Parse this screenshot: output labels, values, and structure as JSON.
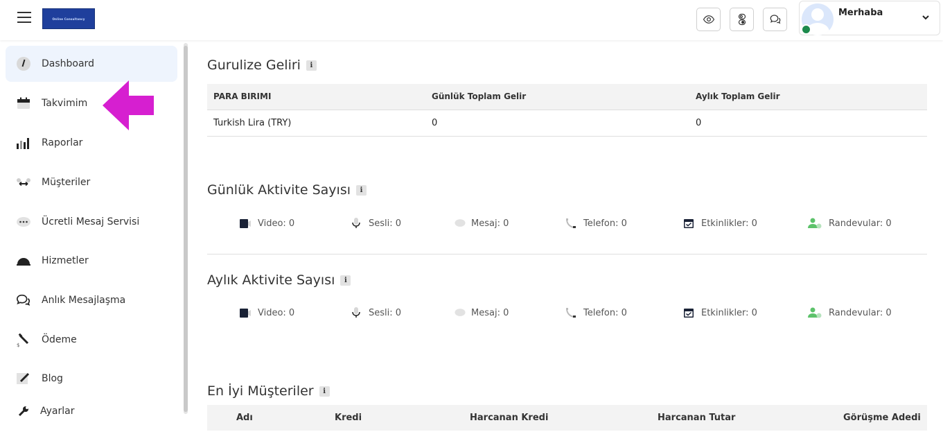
{
  "header": {
    "logo_text": "Online Consultancy",
    "greeting": "Merhaba",
    "chevron": "⌄",
    "icons": [
      "eye-icon",
      "toggle-icon",
      "chat-icon"
    ]
  },
  "sidebar": {
    "items": [
      {
        "label": "Dashboard",
        "icon": "dashboard-icon"
      },
      {
        "label": "Takvimim",
        "icon": "calendar-icon"
      },
      {
        "label": "Raporlar",
        "icon": "bar-chart-icon"
      },
      {
        "label": "Müşteriler",
        "icon": "customers-icon"
      },
      {
        "label": "Ücretli Mesaj Servisi",
        "icon": "message-dots-icon"
      },
      {
        "label": "Hizmetler",
        "icon": "services-icon"
      },
      {
        "label": "Anlık Mesajlaşma",
        "icon": "instant-chat-icon"
      },
      {
        "label": "Ödeme",
        "icon": "payment-icon"
      },
      {
        "label": "Blog",
        "icon": "blog-icon"
      },
      {
        "label": "Ayarlar",
        "icon": "settings-icon"
      }
    ]
  },
  "revenue": {
    "title": "Gurulize Geliri",
    "info": "i",
    "columns": [
      "PARA BIRIMI",
      "Günlük Toplam Gelir",
      "Aylık Toplam Gelir"
    ],
    "rows": [
      [
        "Turkish Lira (TRY)",
        "0",
        "0"
      ]
    ]
  },
  "daily": {
    "title": "Günlük Aktivite Sayısı",
    "info": "i",
    "items": [
      "Video: 0",
      "Sesli: 0",
      "Mesaj: 0",
      "Telefon: 0",
      "Etkinlikler: 0",
      "Randevular: 0"
    ]
  },
  "monthly": {
    "title": "Aylık Aktivite Sayısı",
    "info": "i",
    "items": [
      "Video: 0",
      "Sesli: 0",
      "Mesaj: 0",
      "Telefon: 0",
      "Etkinlikler: 0",
      "Randevular: 0"
    ]
  },
  "top_customers": {
    "title": "En İyi Müşteriler",
    "info": "i",
    "columns": [
      "Adı",
      "Kredi",
      "Harcanan Kredi",
      "Harcanan Tutar",
      "Görüşme Adedi"
    ]
  },
  "colors": {
    "accent_arrow": "#d61fd0",
    "active_bg": "#eef4fd",
    "online": "#1c8a4c",
    "logo_bg": "#1f3f9c",
    "randevu_green": "#5cc26a"
  }
}
